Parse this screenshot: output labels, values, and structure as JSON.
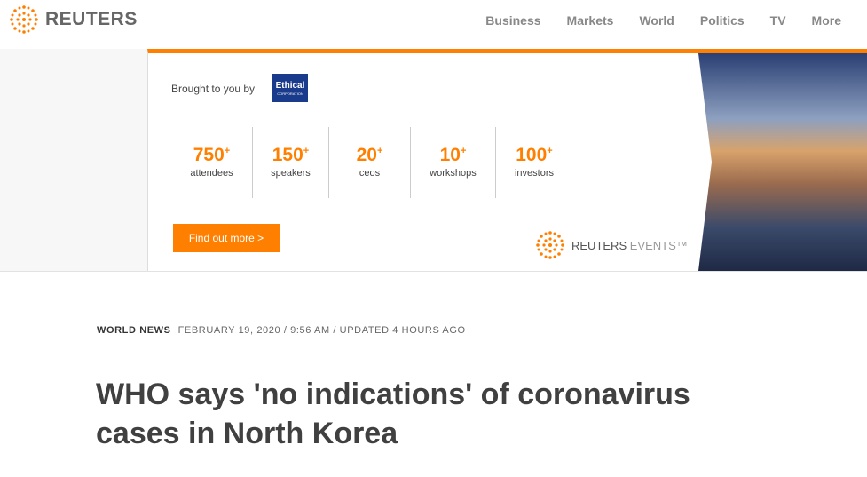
{
  "header": {
    "brand": "REUTERS",
    "nav": [
      "Business",
      "Markets",
      "World",
      "Politics",
      "TV",
      "More"
    ]
  },
  "ad": {
    "brought_by": "Brought to you by",
    "sponsor_logo": "Ethical CORPORATION",
    "stats": [
      {
        "value": "750",
        "suffix": "+",
        "label": "attendees"
      },
      {
        "value": "150",
        "suffix": "+",
        "label": "speakers"
      },
      {
        "value": "20",
        "suffix": "+",
        "label": "ceos"
      },
      {
        "value": "10",
        "suffix": "+",
        "label": "workshops"
      },
      {
        "value": "100",
        "suffix": "+",
        "label": "investors"
      }
    ],
    "cta": "Find out more  >",
    "events_brand": "REUTERS",
    "events_word": "EVENTS™",
    "accent": "#ff8000"
  },
  "article": {
    "section": "WORLD NEWS",
    "dateline": "FEBRUARY 19, 2020 / 9:56 AM / UPDATED 4 HOURS AGO",
    "title": "WHO says 'no indications' of coronavirus cases in North Korea"
  }
}
